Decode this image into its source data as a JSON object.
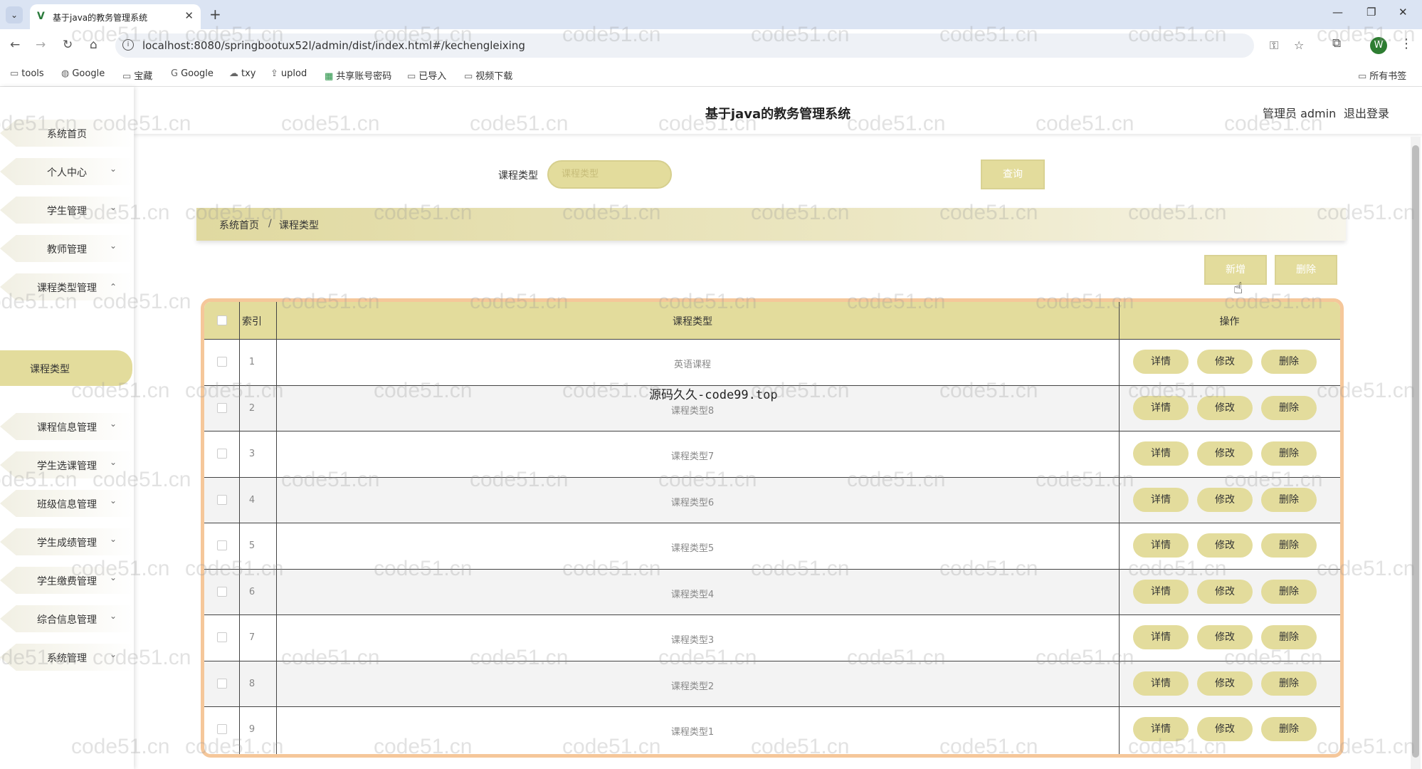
{
  "browser": {
    "tab_title": "基于java的教务管理系统",
    "url": "localhost:8080/springbootux52l/admin/dist/index.html#/kechengleixing",
    "profile_initial": "W",
    "bookmarks": [
      "tools",
      "Google",
      "宝藏",
      "Google",
      "txy",
      "uplod",
      "共享账号密码",
      "已导入",
      "视频下载"
    ],
    "all_bookmarks": "所有书签"
  },
  "header": {
    "title": "基于java的教务管理系统",
    "admin": "管理员 admin",
    "logout": "退出登录"
  },
  "sidebar": {
    "items": [
      {
        "label": "系统首页",
        "has_chevron": false
      },
      {
        "label": "个人中心",
        "has_chevron": true
      },
      {
        "label": "学生管理",
        "has_chevron": true
      },
      {
        "label": "教师管理",
        "has_chevron": true
      },
      {
        "label": "课程类型管理",
        "has_chevron": true,
        "expanded": true
      },
      {
        "label": "课程信息管理",
        "has_chevron": true
      },
      {
        "label": "学生选课管理",
        "has_chevron": true
      },
      {
        "label": "班级信息管理",
        "has_chevron": true
      },
      {
        "label": "学生成绩管理",
        "has_chevron": true
      },
      {
        "label": "学生缴费管理",
        "has_chevron": true
      },
      {
        "label": "综合信息管理",
        "has_chevron": true
      },
      {
        "label": "系统管理",
        "has_chevron": true
      }
    ],
    "active_sub": "课程类型"
  },
  "search": {
    "label": "课程类型",
    "placeholder": "课程类型",
    "button": "查询"
  },
  "breadcrumb": {
    "home": "系统首页",
    "separator": "/",
    "current": "课程类型"
  },
  "actions": {
    "add": "新增",
    "delete": "删除"
  },
  "table": {
    "headers": {
      "index": "索引",
      "name": "课程类型",
      "ops": "操作"
    },
    "row_actions": [
      "详情",
      "修改",
      "删除"
    ],
    "rows": [
      {
        "index": "1",
        "name": "英语课程"
      },
      {
        "index": "2",
        "name": "课程类型8"
      },
      {
        "index": "3",
        "name": "课程类型7"
      },
      {
        "index": "4",
        "name": "课程类型6"
      },
      {
        "index": "5",
        "name": "课程类型5"
      },
      {
        "index": "6",
        "name": "课程类型4"
      },
      {
        "index": "7",
        "name": "课程类型3"
      },
      {
        "index": "8",
        "name": "课程类型2"
      },
      {
        "index": "9",
        "name": "课程类型1"
      }
    ]
  },
  "watermark": {
    "text": "code51.cn",
    "overlay": "源码久久-code99.top"
  },
  "colors": {
    "accent": "#e3dc9c",
    "table_border": "#f5c79a"
  }
}
